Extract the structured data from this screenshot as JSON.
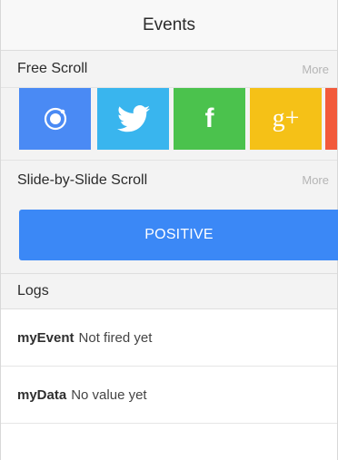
{
  "navbar": {
    "title": "Events"
  },
  "free_scroll": {
    "title": "Free Scroll",
    "more_label": "More",
    "tiles": [
      {
        "icon": "ionic-icon",
        "color": "#4a8af4"
      },
      {
        "icon": "twitter-icon",
        "color": "#39b5ee"
      },
      {
        "icon": "facebook-icon",
        "label": "f",
        "color": "#4bc24d"
      },
      {
        "icon": "google-plus-icon",
        "label": "g+",
        "color": "#f5c117"
      },
      {
        "icon": "partial-tile",
        "color": "#f25a3b"
      }
    ]
  },
  "slide_scroll": {
    "title": "Slide-by-Slide Scroll",
    "more_label": "More",
    "button_label": "POSITIVE"
  },
  "logs": {
    "title": "Logs",
    "rows": [
      {
        "key": "myEvent",
        "value": "Not fired yet"
      },
      {
        "key": "myData",
        "value": "No value yet"
      }
    ]
  }
}
